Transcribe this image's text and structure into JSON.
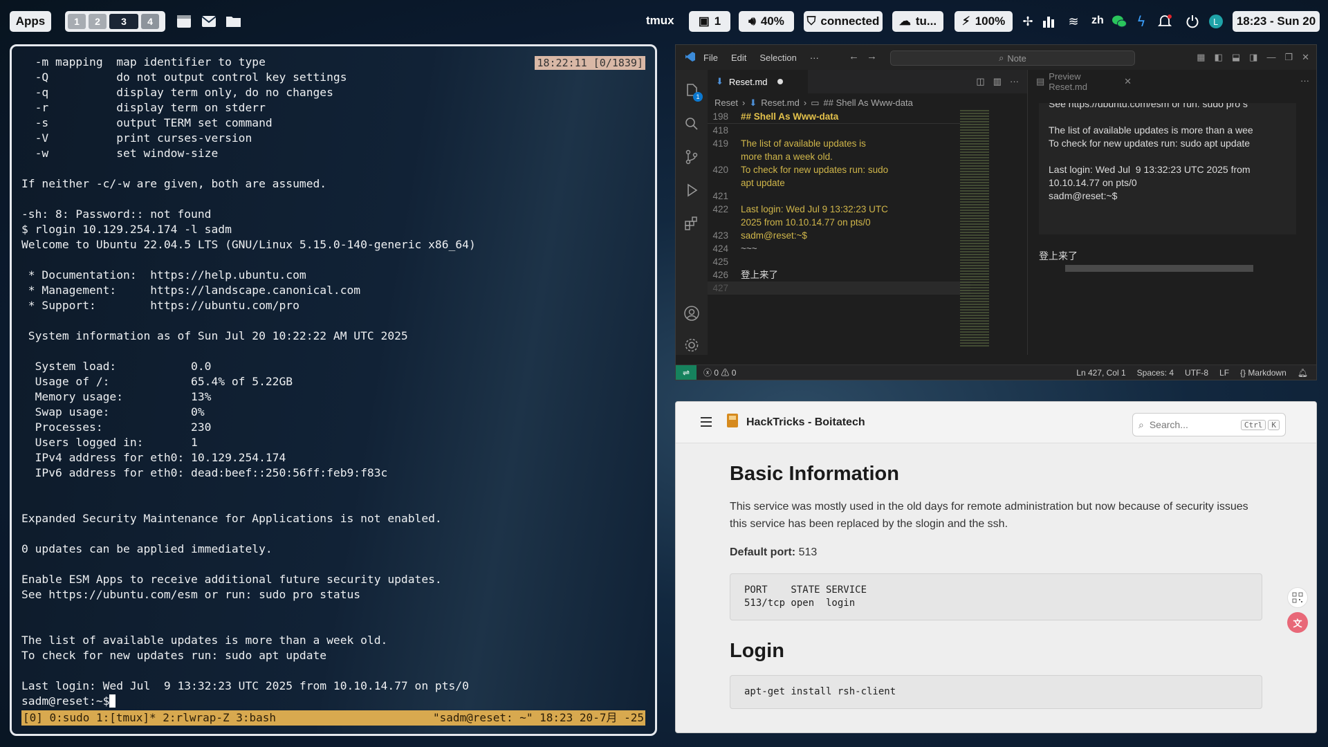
{
  "topbar": {
    "apps_label": "Apps",
    "workspaces": [
      "1",
      "2",
      "3",
      "4"
    ],
    "active_workspace": "3",
    "window_title": "tmux",
    "counter": "1",
    "volume": "40%",
    "vpn_status": "connected",
    "network": "tu...",
    "battery": "100%",
    "lang": "zh",
    "clock": "18:23 - Sun 20"
  },
  "terminal": {
    "clock_badge": "18:22:11 [0/1839]",
    "lines": [
      "  -m mapping  map identifier to type",
      "  -Q          do not output control key settings",
      "  -q          display term only, do no changes",
      "  -r          display term on stderr",
      "  -s          output TERM set command",
      "  -V          print curses-version",
      "  -w          set window-size",
      "",
      "If neither -c/-w are given, both are assumed.",
      "",
      "-sh: 8: Password:: not found",
      "$ rlogin 10.129.254.174 -l sadm",
      "Welcome to Ubuntu 22.04.5 LTS (GNU/Linux 5.15.0-140-generic x86_64)",
      "",
      " * Documentation:  https://help.ubuntu.com",
      " * Management:     https://landscape.canonical.com",
      " * Support:        https://ubuntu.com/pro",
      "",
      " System information as of Sun Jul 20 10:22:22 AM UTC 2025",
      "",
      "  System load:           0.0",
      "  Usage of /:            65.4% of 5.22GB",
      "  Memory usage:          13%",
      "  Swap usage:            0%",
      "  Processes:             230",
      "  Users logged in:       1",
      "  IPv4 address for eth0: 10.129.254.174",
      "  IPv6 address for eth0: dead:beef::250:56ff:feb9:f83c",
      "",
      "",
      "Expanded Security Maintenance for Applications is not enabled.",
      "",
      "0 updates can be applied immediately.",
      "",
      "Enable ESM Apps to receive additional future security updates.",
      "See https://ubuntu.com/esm or run: sudo pro status",
      "",
      "",
      "The list of available updates is more than a week old.",
      "To check for new updates run: sudo apt update",
      "",
      "Last login: Wed Jul  9 13:32:23 UTC 2025 from 10.10.14.77 on pts/0"
    ],
    "prompt": "sadm@reset:~$",
    "status_left": "[0] 0:sudo  1:[tmux]* 2:rlwrap-Z 3:bash",
    "status_right": "\"sadm@reset: ~\" 18:23 20-7月 -25"
  },
  "vscode": {
    "menu": [
      "File",
      "Edit",
      "Selection",
      "···"
    ],
    "search_placeholder": "Note",
    "explorer_badge": "1",
    "tab_label": "Reset.md",
    "breadcrumb": [
      "Reset",
      "Reset.md",
      "## Shell As Www-data"
    ],
    "sticky_line": {
      "num": "198",
      "text": "## Shell As Www-data"
    },
    "code": [
      {
        "num": "418",
        "text": ""
      },
      {
        "num": "419",
        "text": "The list of available updates is"
      },
      {
        "num": "",
        "text": "more than a week old."
      },
      {
        "num": "420",
        "text": "To check for new updates run: sudo"
      },
      {
        "num": "",
        "text": "apt update"
      },
      {
        "num": "421",
        "text": ""
      },
      {
        "num": "422",
        "text": "Last login: Wed Jul  9 13:32:23 UTC"
      },
      {
        "num": "",
        "text": "2025 from 10.10.14.77 on pts/0"
      },
      {
        "num": "423",
        "text": "sadm@reset:~$"
      },
      {
        "num": "424",
        "text": "~~~"
      },
      {
        "num": "425",
        "text": ""
      },
      {
        "num": "426",
        "text": "登上来了"
      },
      {
        "num": "427",
        "text": ""
      }
    ],
    "preview_tab": "Preview Reset.md",
    "preview_lines": [
      "See https://ubuntu.com/esm or run: sudo pro s",
      "",
      "The list of available updates is more than a wee",
      "To check for new updates run: sudo apt update",
      "",
      "Last login: Wed Jul  9 13:32:23 UTC 2025 from",
      "10.10.14.77 on pts/0",
      "sadm@reset:~$"
    ],
    "preview_after": "登上来了",
    "status": {
      "problems": "0",
      "warnings": "0",
      "position": "Ln 427, Col 1",
      "spaces": "Spaces: 4",
      "encoding": "UTF-8",
      "eol": "LF",
      "language": "Markdown"
    }
  },
  "browser": {
    "site_title": "HackTricks - Boitatech",
    "search_placeholder": "Search...",
    "kbd_ctrl": "Ctrl",
    "kbd_k": "K",
    "h1_basic": "Basic Information",
    "para_basic": "This service was mostly used in the old days for remote administration but now because of security issues this service has been replaced by the slogin and the ssh.",
    "default_port_label": "Default port:",
    "default_port_value": "513",
    "code_ports": "PORT    STATE SERVICE\n513/tcp open  login",
    "h1_login": "Login",
    "code_login": "apt-get install rsh-client"
  }
}
